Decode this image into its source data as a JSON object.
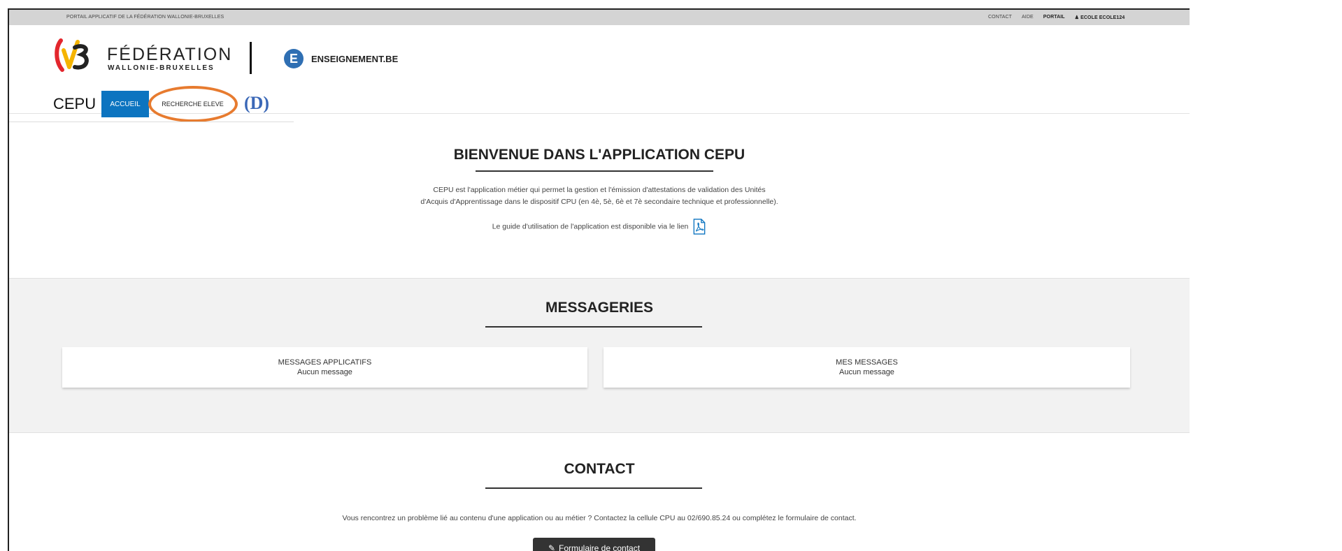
{
  "topbar": {
    "portal_label": "PORTAIL APPLICATIF DE LA FÉDÉRATION WALLONIE-BRUXELLES",
    "links": {
      "contact": "CONTACT",
      "aide": "AIDE",
      "portail": "PORTAIL",
      "user": "ECOLE ECOLE124"
    }
  },
  "header": {
    "fwb_line1": "FÉDÉRATION",
    "fwb_line2": "WALLONIE-BRUXELLES",
    "ens_letter": "E",
    "ens_name": "ENSEIGNEMENT.BE",
    "app_name": "CEPU",
    "nav": {
      "accueil": "ACCUEIL",
      "recherche": "RECHERCHE ELEVE"
    },
    "annotation": "(D)"
  },
  "welcome": {
    "title": "BIENVENUE DANS L'APPLICATION CEPU",
    "line1": "CEPU est l'application métier qui permet la gestion et l'émission d'attestations de validation des Unités",
    "line2": "d'Acquis d'Apprentissage dans le dispositif CPU (en 4è, 5è, 6è et 7è secondaire technique et professionnelle).",
    "guide": "Le guide d'utilisation de l'application est disponible via le lien"
  },
  "messageries": {
    "title": "MESSAGERIES",
    "cards": [
      {
        "title": "MESSAGES APPLICATIFS",
        "status": "Aucun message"
      },
      {
        "title": "MES MESSAGES",
        "status": "Aucun message"
      }
    ]
  },
  "contact": {
    "title": "CONTACT",
    "text": "Vous rencontrez un problème lié au contenu d'une application ou au métier ? Contactez la cellule CPU au 02/690.85.24 ou complétez le formulaire de contact.",
    "button": "Formulaire de contact"
  },
  "colors": {
    "accent": "#0c74c0",
    "annotation_ellipse": "#e77b2f",
    "annotation_text": "#3b68b7"
  }
}
